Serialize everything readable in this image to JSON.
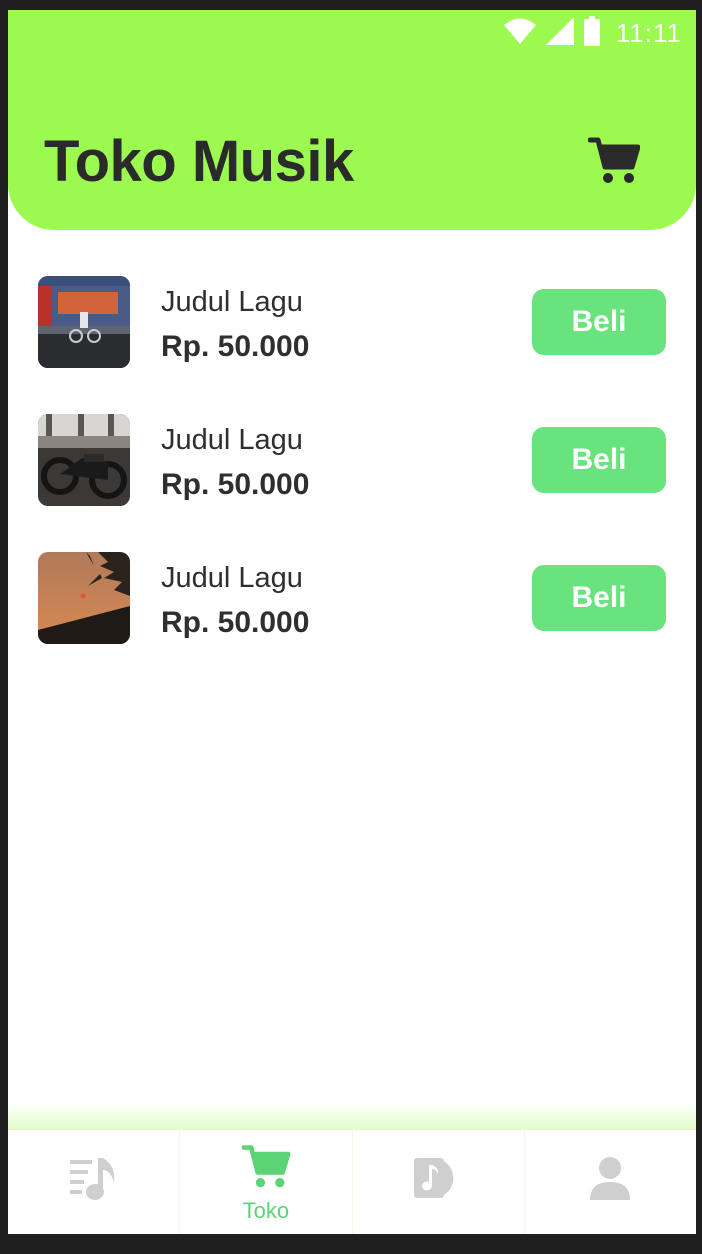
{
  "status_bar": {
    "time": "11:11"
  },
  "header": {
    "title": "Toko Musik",
    "cart_icon": "shopping-cart-icon"
  },
  "colors": {
    "header_bg": "#9bf94f",
    "button_bg": "#69e37e",
    "active_nav": "#5ad474",
    "inactive_nav": "#cfcfcf",
    "text": "#2f2f2f"
  },
  "products": [
    {
      "title": "Judul Lagu",
      "price": "Rp. 50.000",
      "button": "Beli",
      "thumbnail": "street-cyclist-photo"
    },
    {
      "title": "Judul Lagu",
      "price": "Rp. 50.000",
      "button": "Beli",
      "thumbnail": "motorcycle-photo"
    },
    {
      "title": "Judul Lagu",
      "price": "Rp. 50.000",
      "button": "Beli",
      "thumbnail": "sunset-palm-photo"
    }
  ],
  "bottom_nav": {
    "items": [
      {
        "icon": "playlist-music-icon",
        "label": ""
      },
      {
        "icon": "shopping-cart-icon",
        "label": "Toko",
        "active": true
      },
      {
        "icon": "music-album-icon",
        "label": ""
      },
      {
        "icon": "user-profile-icon",
        "label": ""
      }
    ]
  }
}
